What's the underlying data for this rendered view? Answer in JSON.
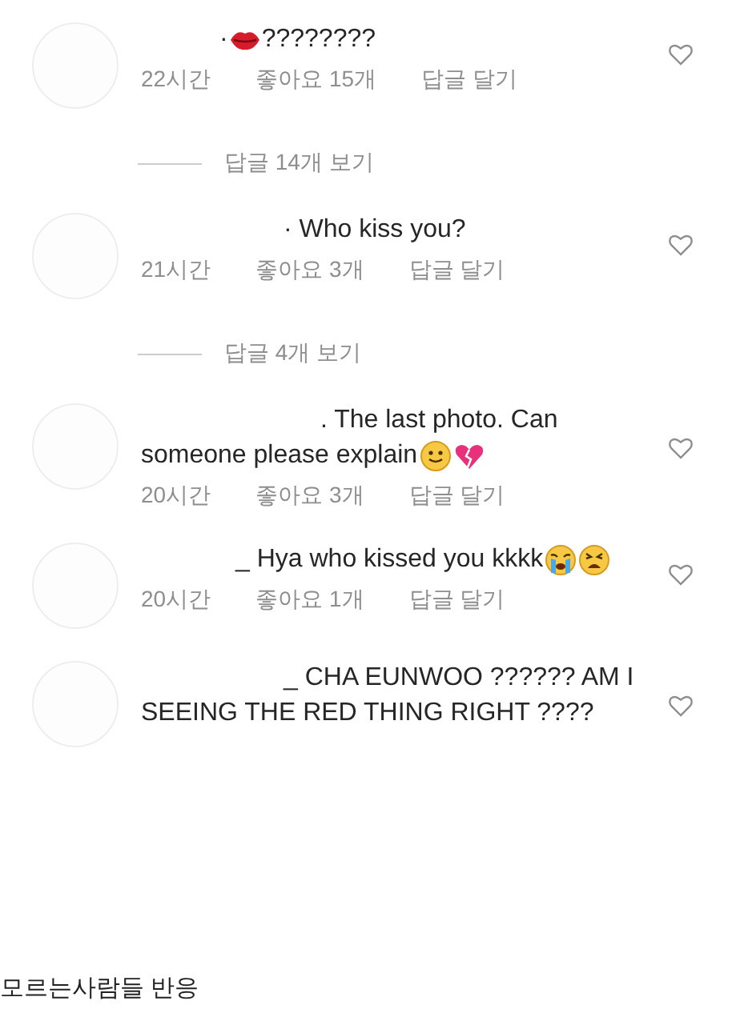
{
  "comments": [
    {
      "lines": [
        [
          {
            "kind": "text",
            "text": "·"
          },
          {
            "kind": "lips"
          },
          {
            "kind": "text",
            "text": "????????"
          }
        ]
      ],
      "time": "22시간",
      "likes": "좋아요 15개",
      "reply": "답글 달기",
      "liked": false,
      "view_replies": "답글 14개 보기"
    },
    {
      "lines": [
        [
          {
            "kind": "text",
            "text": "· Who kiss you?"
          }
        ]
      ],
      "time": "21시간",
      "likes": "좋아요 3개",
      "reply": "답글 달기",
      "liked": false,
      "view_replies": "답글 4개 보기"
    },
    {
      "lines": [
        [
          {
            "kind": "text",
            "text": ". The last photo. Can"
          }
        ],
        [
          {
            "kind": "text",
            "text": "someone please explain"
          },
          {
            "kind": "smile"
          },
          {
            "kind": "broken-heart"
          }
        ]
      ],
      "time": "20시간",
      "likes": "좋아요 3개",
      "reply": "답글 달기",
      "liked": false
    },
    {
      "lines": [
        [
          {
            "kind": "text",
            "text": "_ Hya who kissed you kkkk"
          },
          {
            "kind": "crying"
          },
          {
            "kind": "weary"
          }
        ]
      ],
      "time": "20시간",
      "likes": "좋아요 1개",
      "reply": "답글 달기",
      "liked": false
    },
    {
      "lines": [
        [
          {
            "kind": "text",
            "text": "_ CHA EUNWOO ?????? AM I"
          }
        ],
        [
          {
            "kind": "text",
            "text": "SEEING THE RED THING RIGHT ????"
          }
        ]
      ],
      "liked": false
    }
  ],
  "caption": "모르는사람들 반응"
}
